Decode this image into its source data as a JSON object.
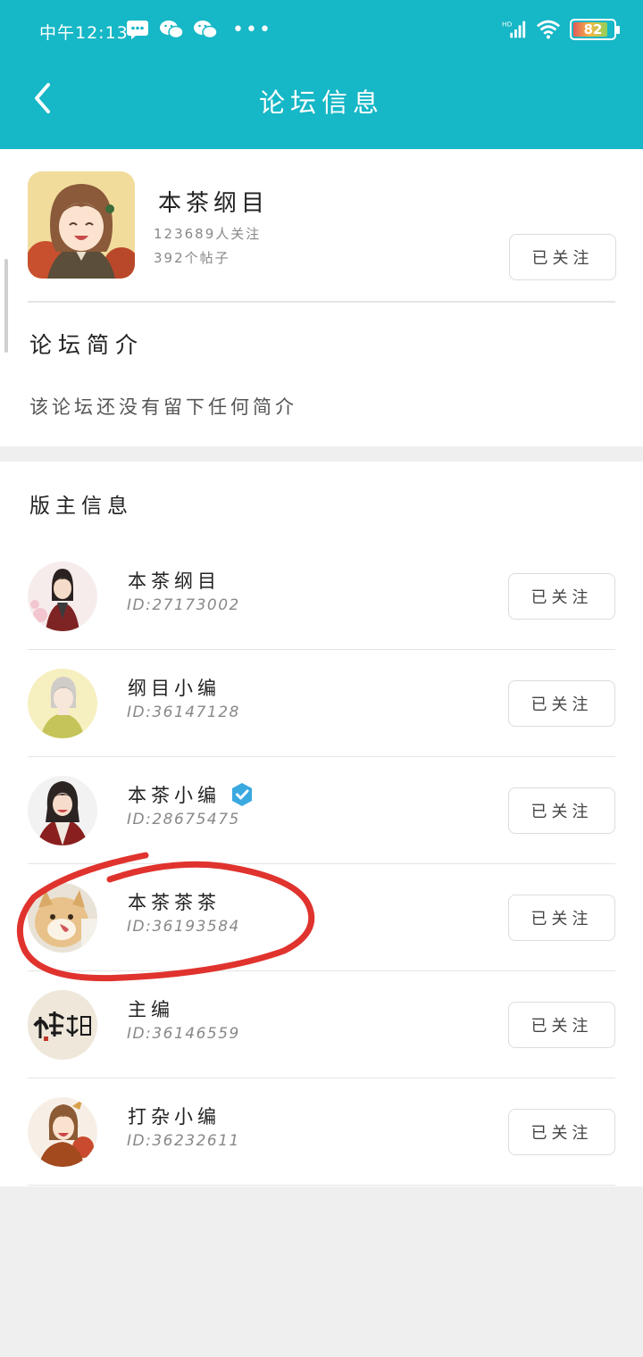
{
  "status_bar": {
    "time": "中午12:13",
    "battery": "82",
    "network": "HD"
  },
  "nav": {
    "title": "论坛信息"
  },
  "forum": {
    "name": "本茶纲目",
    "followers": "123689人关注",
    "posts": "392个帖子",
    "follow_label": "已关注",
    "intro_title": "论坛简介",
    "intro_text": "该论坛还没有留下任何简介"
  },
  "moderators": {
    "title": "版主信息",
    "items": [
      {
        "name": "本茶纲目",
        "id": "ID:27173002",
        "follow_label": "已关注",
        "verified": false,
        "avatar": "avatar-red-robe"
      },
      {
        "name": "纲目小编",
        "id": "ID:36147128",
        "follow_label": "已关注",
        "verified": false,
        "avatar": "avatar-silver-hair"
      },
      {
        "name": "本茶小编",
        "id": "ID:28675475",
        "follow_label": "已关注",
        "verified": true,
        "avatar": "avatar-dark-hair"
      },
      {
        "name": "本茶茶茶",
        "id": "ID:36193584",
        "follow_label": "已关注",
        "verified": false,
        "avatar": "avatar-cat"
      },
      {
        "name": "主编",
        "id": "ID:36146559",
        "follow_label": "已关注",
        "verified": false,
        "avatar": "avatar-calligraphy"
      },
      {
        "name": "打杂小编",
        "id": "ID:36232611",
        "follow_label": "已关注",
        "verified": false,
        "avatar": "avatar-brown-hair"
      }
    ]
  },
  "colors": {
    "header": "#16b7c6",
    "annotation": "#e0332e",
    "verified": "#3aa9e0"
  }
}
